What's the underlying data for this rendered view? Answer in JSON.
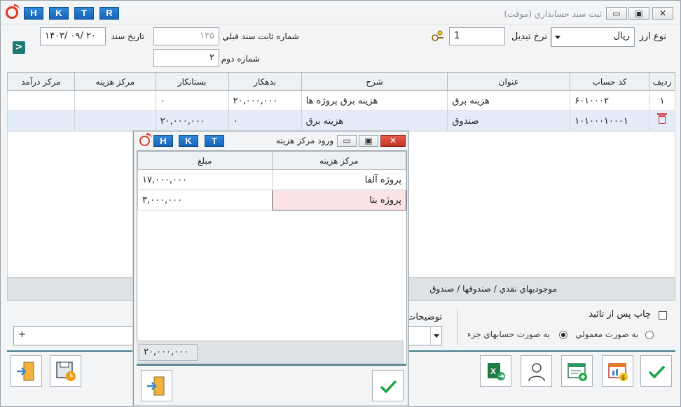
{
  "window": {
    "title": "ثبت سند حسابداري (موقت)",
    "hkt": [
      "H",
      "K",
      "T",
      "R"
    ]
  },
  "header": {
    "currency_type_label": "نوع ارز",
    "currency_value": "ريال",
    "exchange_rate_label": "نرخ تبديل",
    "exchange_rate_value": "1",
    "prev_doc_label": "شماره ثابت سند قبلي",
    "prev_doc_value": "۱۳۵",
    "second_number_label": "شماره دوم",
    "second_number_value": "۲",
    "doc_date_label": "تاريخ سند",
    "doc_date_value": "۱۴۰۳/ ۰۹/ ۲۰",
    "nav_button": ">"
  },
  "grid": {
    "columns": [
      "رديف",
      "کد حساب",
      "عنوان",
      "شرح",
      "بدهکار",
      "بستانکار",
      "مرکز هزينه",
      "مرکز درآمد"
    ],
    "rows": [
      {
        "row": "۱",
        "code": "۶۰۱۰۰۰۲",
        "title": "هزينه برق",
        "desc": "هزينه برق پروژه ها",
        "debit": "۲۰,۰۰۰,۰۰۰",
        "credit": "۰",
        "cost_center": "",
        "income_center": ""
      },
      {
        "row": "",
        "code": "۱۰۱۰۰۰۱۰۰۰۱",
        "title": "صندوق",
        "desc": "هزينه برق",
        "debit": "۰",
        "credit": "۲۰,۰۰۰,۰۰۰",
        "cost_center": "",
        "income_center": ""
      }
    ]
  },
  "path": "موجوديهاي نقدي / صندوقها / صندوق",
  "options": {
    "print_after_confirm": "چاپ پس از تائيد",
    "normal_mode": "به صورت معمولي",
    "detail_mode": "به صورت حسابهاي جزء",
    "description_label": "توضيحات",
    "plus": "+"
  },
  "dialog": {
    "title": "ورود مرکز هزينه",
    "hkt": [
      "H",
      "K",
      "T"
    ],
    "columns": [
      "مرکز هزينه",
      "مبلغ"
    ],
    "rows": [
      {
        "center": "پروژه آلفا",
        "amount": "۱۷,۰۰۰,۰۰۰"
      },
      {
        "center": "پروژه بتا",
        "amount": "۳,۰۰۰,۰۰۰"
      }
    ],
    "total": "۲۰,۰۰۰,۰۰۰"
  },
  "colors": {
    "accent_blue": "#1766b8",
    "logo_red": "#e03a26",
    "confirm_green": "#1aa64a",
    "selection": "#e3ecf8"
  }
}
